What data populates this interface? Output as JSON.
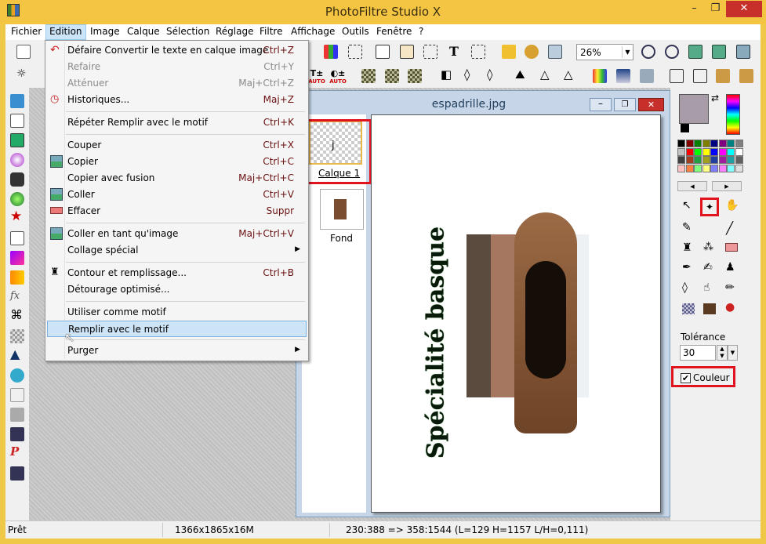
{
  "window": {
    "title": "PhotoFiltre Studio X",
    "minimize_glyph": "–",
    "restore_glyph": "❐",
    "close_glyph": "✕"
  },
  "menubar": [
    "Fichier",
    "Edition",
    "Image",
    "Calque",
    "Sélection",
    "Réglage",
    "Filtre",
    "Affichage",
    "Outils",
    "Fenêtre",
    "?"
  ],
  "toolbar": {
    "zoom_value": "26%",
    "auto_label": "AUTO"
  },
  "edit_menu": {
    "items": [
      {
        "label": "Défaire Convertir le texte en calque image",
        "shortcut": "Ctrl+Z",
        "icon": "undo-icon"
      },
      {
        "label": "Refaire",
        "shortcut": "Ctrl+Y",
        "icon": "redo-icon",
        "disabled": true
      },
      {
        "label": "Atténuer",
        "shortcut": "Maj+Ctrl+Z",
        "disabled": true
      },
      {
        "label": "Historiques...",
        "shortcut": "Maj+Z",
        "icon": "history-icon"
      },
      {
        "label": "Répéter Remplir avec le motif",
        "shortcut": "Ctrl+K"
      },
      {
        "label": "Couper",
        "shortcut": "Ctrl+X"
      },
      {
        "label": "Copier",
        "shortcut": "Ctrl+C",
        "icon": "copy-icon"
      },
      {
        "label": "Copier avec fusion",
        "shortcut": "Maj+Ctrl+C"
      },
      {
        "label": "Coller",
        "shortcut": "Ctrl+V",
        "icon": "paste-icon"
      },
      {
        "label": "Effacer",
        "shortcut": "Suppr",
        "icon": "eraser-icon"
      },
      {
        "label": "Coller en tant qu'image",
        "shortcut": "Maj+Ctrl+V",
        "icon": "paste-image-icon"
      },
      {
        "label": "Collage spécial",
        "shortcut": ""
      },
      {
        "label": "Contour et remplissage...",
        "shortcut": "Ctrl+B",
        "icon": "fill-icon"
      },
      {
        "label": "Détourage optimisé...",
        "shortcut": ""
      },
      {
        "label": "Utiliser comme motif",
        "shortcut": ""
      },
      {
        "label": "Remplir avec le motif",
        "shortcut": "",
        "highlighted": true
      },
      {
        "label": "Purger",
        "shortcut": ""
      }
    ]
  },
  "document": {
    "title": "espadrille.jpg",
    "layers": [
      {
        "label": "Calque 1",
        "selected": true
      },
      {
        "label": "Fond"
      }
    ],
    "canvas_text": "Spécialité basque"
  },
  "right_panel": {
    "tolerance_label": "Tolérance",
    "tolerance_value": "30",
    "color_checkbox_label": "Couleur",
    "color_checked": true,
    "foreground_color": "#a79ca8",
    "background_color": "#000000"
  },
  "status": {
    "state": "Prêt",
    "image_size": "1366x1865x16M",
    "coordinates": "230:388 => 358:1544 (L=129  H=1157  L/H=0,111)"
  },
  "palette_colors": [
    "#000000",
    "#800000",
    "#008000",
    "#808000",
    "#000080",
    "#800080",
    "#008080",
    "#808080",
    "#c0c0c0",
    "#ff0000",
    "#00ff00",
    "#ffff00",
    "#0000ff",
    "#ff00ff",
    "#00ffff",
    "#ffffff",
    "#404040",
    "#a04020",
    "#20a040",
    "#a0a020",
    "#2040a0",
    "#a020a0",
    "#20a0a0",
    "#606060",
    "#ffc0c0",
    "#ff8040",
    "#80ff80",
    "#ffff80",
    "#8080ff",
    "#ff80ff",
    "#80ffff",
    "#e0e0e0"
  ]
}
